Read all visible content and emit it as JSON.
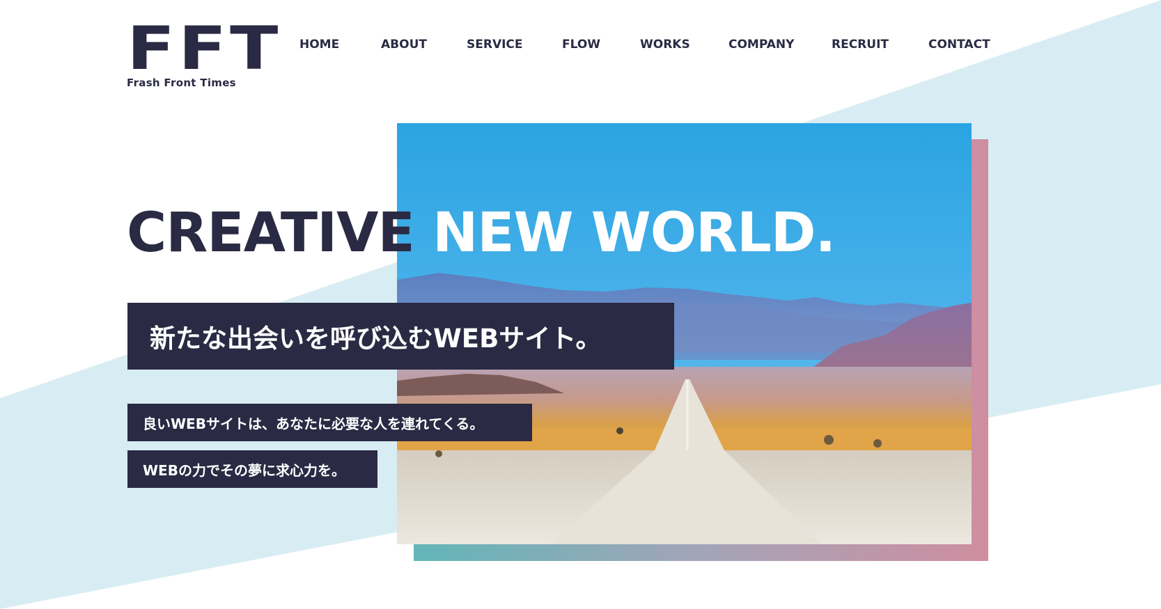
{
  "brand": {
    "logo_mark": "FFT",
    "tagline": "Frash Front Times"
  },
  "nav": {
    "items": [
      {
        "label": "HOME"
      },
      {
        "label": "ABOUT"
      },
      {
        "label": "SERVICE"
      },
      {
        "label": "FLOW"
      },
      {
        "label": "WORKS"
      },
      {
        "label": "COMPANY"
      },
      {
        "label": "RECRUIT"
      },
      {
        "label": "CONTACT"
      }
    ]
  },
  "hero": {
    "headline_dark": "CREATIVE",
    "headline_light": "NEW WORLD.",
    "subheadline": "新たな出会いを呼び込むWEBサイト。",
    "lines": [
      "良いWEBサイトは、あなたに必要な人を連れてくる。",
      "WEBの力でその夢に求心力を。"
    ],
    "image_icon": "desert-road-photo"
  },
  "colors": {
    "navy": "#2a2a44",
    "light_blue_band": "#d8edf3",
    "gradient_start": "#62b6b8",
    "gradient_end": "#cf8ea0",
    "white": "#ffffff"
  }
}
